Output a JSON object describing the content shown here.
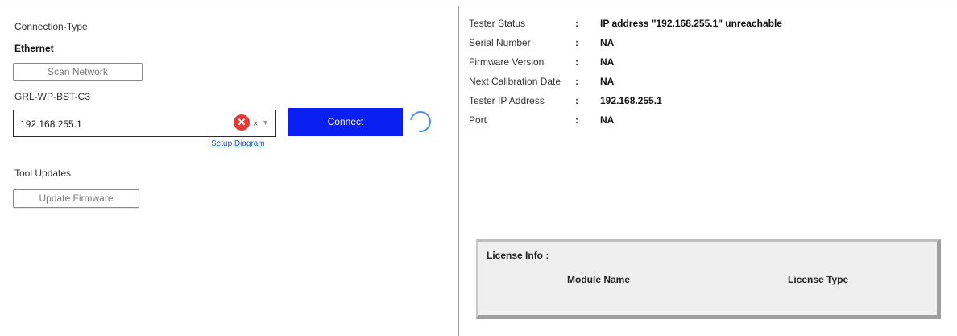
{
  "left": {
    "connection_type_label": "Connection-Type",
    "connection_type_value": "Ethernet",
    "scan_button": "Scan Network",
    "device_name": "GRL-WP-BST-C3",
    "ip_value": "192.168.255.1",
    "error_icon_glyph": "✕",
    "clear_glyph": "×",
    "dropdown_glyph": "▼",
    "setup_link": "Setup Diagram",
    "connect_button": "Connect",
    "tool_updates_label": "Tool Updates",
    "update_button": "Update Firmware"
  },
  "status": {
    "separator": ":",
    "rows": [
      {
        "label": "Tester Status",
        "value": "IP address \"192.168.255.1\" unreachable"
      },
      {
        "label": "Serial Number",
        "value": "NA"
      },
      {
        "label": "Firmware Version",
        "value": "NA"
      },
      {
        "label": "Next Calibration Date",
        "value": "NA"
      },
      {
        "label": "Tester IP Address",
        "value": "192.168.255.1"
      },
      {
        "label": "Port",
        "value": "NA"
      }
    ]
  },
  "license": {
    "title": "License Info :",
    "col_module": "Module Name",
    "col_type": "License Type"
  },
  "colors": {
    "connect_bg": "#0c1ff2",
    "link": "#1a56d6",
    "error": "#e53935",
    "spinner": "#4f8ff0"
  }
}
